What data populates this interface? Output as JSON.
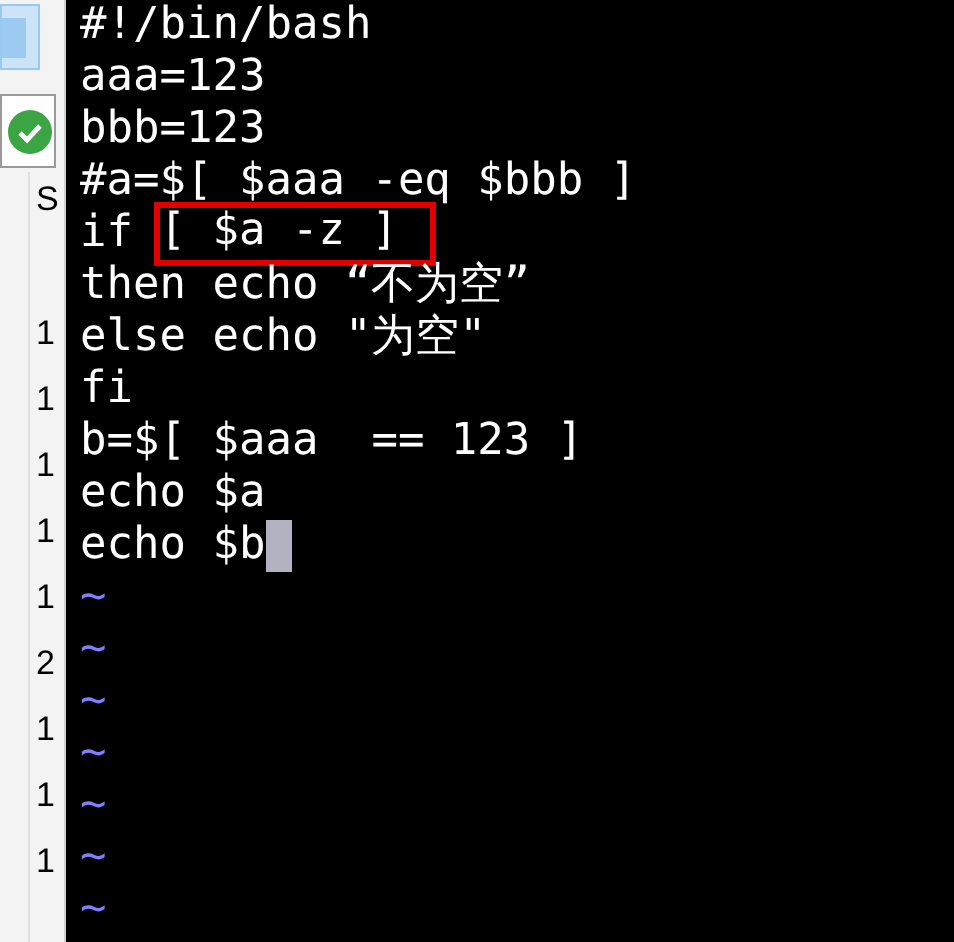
{
  "side_panel": {
    "column_heading": "S",
    "cells": [
      "1",
      "1",
      "1",
      "1",
      "1",
      "2",
      "1",
      "1",
      "1"
    ]
  },
  "editor": {
    "lines": [
      {
        "kind": "plain",
        "text": "#!/bin/bash",
        "cursor": false
      },
      {
        "kind": "plain",
        "text": "aaa=123",
        "cursor": false
      },
      {
        "kind": "plain",
        "text": "bbb=123",
        "cursor": false
      },
      {
        "kind": "plain",
        "text": "#a=$[ $aaa -eq $bbb ]",
        "cursor": false
      },
      {
        "kind": "boxed",
        "text": "if ",
        "boxed": "[ $a -z ]",
        "cursor": false
      },
      {
        "kind": "plain",
        "text": "then echo “不为空”",
        "cursor": false
      },
      {
        "kind": "plain",
        "text": "else echo \"为空\"",
        "cursor": false
      },
      {
        "kind": "plain",
        "text": "fi",
        "cursor": false
      },
      {
        "kind": "plain",
        "text": "b=$[ $aaa  == 123 ]",
        "cursor": false
      },
      {
        "kind": "plain",
        "text": "echo $a",
        "cursor": false
      },
      {
        "kind": "plain",
        "text": "echo $b",
        "cursor": true
      },
      {
        "kind": "tilde",
        "text": "~"
      },
      {
        "kind": "tilde",
        "text": "~"
      },
      {
        "kind": "tilde",
        "text": "~"
      },
      {
        "kind": "tilde",
        "text": "~"
      },
      {
        "kind": "tilde",
        "text": "~"
      },
      {
        "kind": "tilde",
        "text": "~"
      },
      {
        "kind": "tilde",
        "text": "~"
      }
    ]
  }
}
